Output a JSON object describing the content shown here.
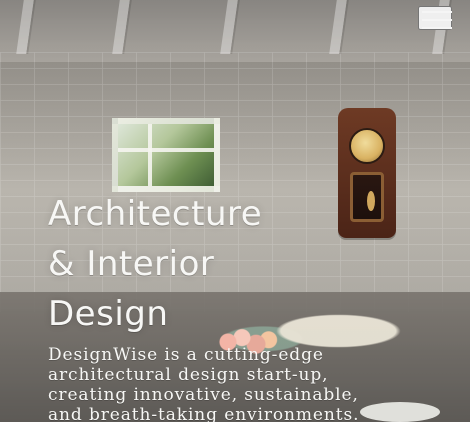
{
  "hero": {
    "title_lines": [
      "Architecture",
      "& Interior",
      "Design"
    ],
    "description_lines": [
      "DesignWise is a cutting-edge",
      "architectural design start-up,",
      "creating innovative, sustainable,",
      "and breath-taking environments."
    ]
  },
  "header": {
    "menu_icon": "hamburger-menu-icon"
  },
  "colors": {
    "text": "#f7f7f5",
    "menu": "#f5f5f5",
    "overlay": "#6f6a63"
  }
}
